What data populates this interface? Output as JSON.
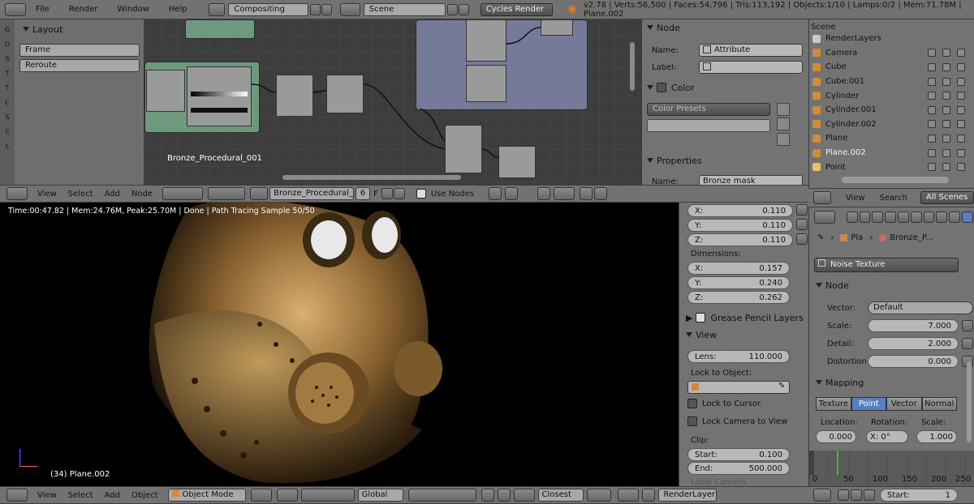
{
  "topbar": {
    "menus": [
      "File",
      "Render",
      "Window",
      "Help"
    ],
    "layout": "Compositing",
    "scene": "Scene",
    "engine": "Cycles Render",
    "stats": "v2.78 | Verts:56,500 | Faces:54,796 | Tris:113,192 | Objects:1/10 | Lamps:0/2 | Mem:71.78M | Plane.002"
  },
  "toolshelf": {
    "panel": "Layout",
    "buttons": [
      "Frame",
      "Reroute"
    ],
    "tabs": [
      "Grease",
      "Options",
      "Shading",
      "Tool",
      "Tools",
      "Create",
      "Shading",
      "Custom",
      "Layout"
    ]
  },
  "nodeeditor": {
    "frame_label": "Bronze_Procedural_001",
    "menus": [
      "View",
      "Select",
      "Add",
      "Node"
    ],
    "material": "Bronze_Procedural_...",
    "users": "6",
    "use_nodes": "Use Nodes"
  },
  "nodeprops": {
    "node_panel": "Node",
    "name_label": "Name:",
    "name_value": "Attribute",
    "label_label": "Label:",
    "color_panel": "Color",
    "color_presets": "Color Presets",
    "properties_panel": "Properties",
    "prop_name_label": "Name:",
    "prop_name_value": "Bronze mask"
  },
  "outliner": {
    "title": "Scene",
    "items": [
      {
        "name": "RenderLayers",
        "color": "#c8c8c8"
      },
      {
        "name": "Camera",
        "color": "#d08a3a"
      },
      {
        "name": "Cube",
        "color": "#d08a3a"
      },
      {
        "name": "Cube.001",
        "color": "#d08a3a"
      },
      {
        "name": "Cylinder",
        "color": "#d08a3a"
      },
      {
        "name": "Cylinder.001",
        "color": "#d08a3a"
      },
      {
        "name": "Cylinder.002",
        "color": "#d08a3a"
      },
      {
        "name": "Plane",
        "color": "#d08a3a"
      },
      {
        "name": "Plane.002",
        "color": "#d08a3a"
      },
      {
        "name": "Point",
        "color": "#e8c060"
      }
    ],
    "menus": [
      "View",
      "Search"
    ],
    "filter": "All Scenes"
  },
  "viewport": {
    "status": "Time:00:47.82 | Mem:24.76M, Peak:25.70M | Done | Path Tracing Sample 50/50",
    "object_label": "(34) Plane.002",
    "menus": [
      "View",
      "Select",
      "Add",
      "Object"
    ],
    "mode": "Object Mode",
    "orientation": "Global",
    "snap": "Closest",
    "layer": "RenderLayer"
  },
  "viewprops": {
    "scale_x": "0.110",
    "scale_y": "0.110",
    "scale_z": "0.110",
    "dims_label": "Dimensions:",
    "dim_x": "0.157",
    "dim_y": "0.240",
    "dim_z": "0.262",
    "grease_pencil": "Grease Pencil Layers",
    "view_panel": "View",
    "lens_label": "Lens:",
    "lens_value": "110.000",
    "lock_obj_label": "Lock to Object:",
    "lock_cursor": "Lock to Cursor",
    "lock_camera": "Lock Camera to View",
    "clip_label": "Clip:",
    "clip_start_label": "Start:",
    "clip_start": "0.100",
    "clip_end_label": "End:",
    "clip_end": "500.000",
    "local_camera": "Local Camera"
  },
  "texprops": {
    "breadcrumb_obj": "Pla",
    "breadcrumb_mat": "Bronze_P...",
    "texture": "Noise Texture",
    "node_panel": "Node",
    "vector_label": "Vector:",
    "vector_value": "Default",
    "scale_label": "Scale:",
    "scale_value": "7.000",
    "detail_label": "Detail:",
    "detail_value": "2.000",
    "distortion_label": "Distortion",
    "distortion_value": "0.000",
    "mapping_panel": "Mapping",
    "mapping_tabs": [
      "Texture",
      "Point",
      "Vector",
      "Normal"
    ],
    "location_label": "Location:",
    "rotation_label": "Rotation:",
    "scale2_label": "Scale:",
    "loc_x": "0.000",
    "rot_x": "X:  0°",
    "scale_x": "1.000"
  },
  "timeline": {
    "ticks": [
      "0",
      "50",
      "100",
      "150",
      "200",
      "250"
    ],
    "start_label": "Start:",
    "start_value": "1"
  },
  "colors": {
    "accent": "#5680c2",
    "header": "#727272",
    "panel": "#737373"
  }
}
